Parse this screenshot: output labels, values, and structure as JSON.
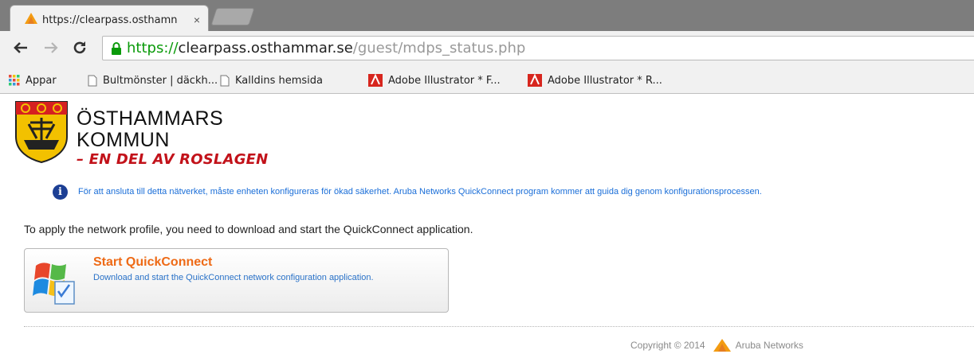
{
  "browser": {
    "tab": {
      "title": "https://clearpass.osthamn",
      "close_glyph": "×"
    },
    "url": {
      "scheme": "https://",
      "host": "clearpass.osthammar.se",
      "path": "/guest/mdps_status.php"
    },
    "bookmarks": [
      {
        "label": "Appar",
        "icon": "apps-grid-icon"
      },
      {
        "label": "Bultmönster | däckh...",
        "icon": "page-icon"
      },
      {
        "label": "Kalldins hemsida",
        "icon": "page-icon"
      },
      {
        "label": "Adobe Illustrator * F...",
        "icon": "adobe-icon"
      },
      {
        "label": "Adobe Illustrator * R...",
        "icon": "adobe-icon"
      }
    ]
  },
  "page": {
    "logo": {
      "line1": "ÖSTHAMMARS",
      "line2": "KOMMUN",
      "line3": "– EN DEL AV ROSLAGEN"
    },
    "info_text": "För att ansluta till detta nätverket, måste enheten konfigureras för ökad säkerhet. Aruba Networks QuickConnect program kommer att guida dig genom konfigurationsprocessen.",
    "instruction": "To apply the network profile, you need to download and start the QuickConnect application.",
    "quickconnect": {
      "title": "Start QuickConnect",
      "description": "Download and start the QuickConnect network configuration application."
    },
    "footer": {
      "copyright": "Copyright © 2014",
      "brand": "Aruba Networks"
    }
  },
  "colors": {
    "tabstrip": "#7d7d7d",
    "toolbar": "#f1f1f1",
    "url_scheme": "#0a9a0a",
    "info_text": "#1a6ed8",
    "quickconnect_title": "#ee6a16",
    "logo_red": "#c2121a",
    "aruba_orange": "#f39c12"
  }
}
